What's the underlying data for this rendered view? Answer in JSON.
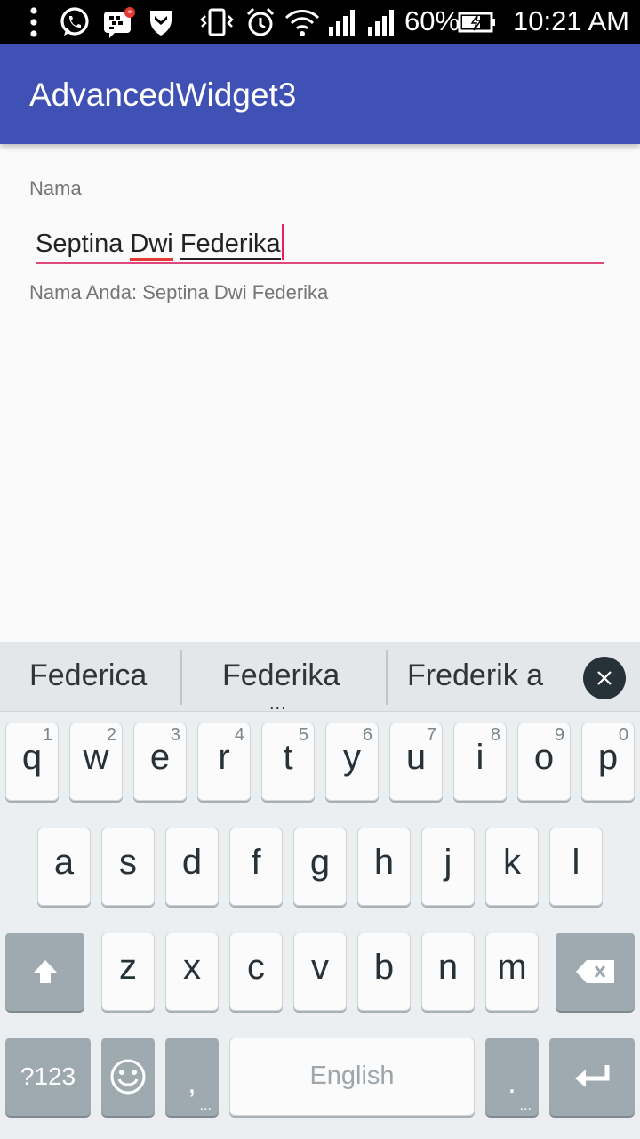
{
  "status_bar": {
    "battery_percent": "60%",
    "time": "10:21 AM",
    "icons": [
      "overflow-menu-icon",
      "whatsapp-icon",
      "bbm-icon",
      "shield-icon",
      "vibrate-icon",
      "alarm-icon",
      "wifi-icon",
      "signal-icon",
      "signal-icon-2",
      "battery-charging-icon"
    ]
  },
  "app_bar": {
    "title": "AdvancedWidget3",
    "color": "#3f51b5"
  },
  "form": {
    "label": "Nama",
    "input_value": "Septina Dwi Federika",
    "input_word_1": "Septina ",
    "input_word_2": "Dwi",
    "input_word_3": "Federika",
    "output": "Nama Anda: Septina Dwi Federika",
    "accent_color": "#e91e63"
  },
  "keyboard": {
    "suggestions": [
      "Federica",
      "Federika",
      "Frederik a"
    ],
    "suggestion_more": "...",
    "row1": [
      {
        "k": "q",
        "h": "1"
      },
      {
        "k": "w",
        "h": "2"
      },
      {
        "k": "e",
        "h": "3"
      },
      {
        "k": "r",
        "h": "4"
      },
      {
        "k": "t",
        "h": "5"
      },
      {
        "k": "y",
        "h": "6"
      },
      {
        "k": "u",
        "h": "7"
      },
      {
        "k": "i",
        "h": "8"
      },
      {
        "k": "o",
        "h": "9"
      },
      {
        "k": "p",
        "h": "0"
      }
    ],
    "row2": [
      "a",
      "s",
      "d",
      "f",
      "g",
      "h",
      "j",
      "k",
      "l"
    ],
    "row3": [
      "z",
      "x",
      "c",
      "v",
      "b",
      "n",
      "m"
    ],
    "symbols_label": "?123",
    "comma_label": ",",
    "space_label": "English",
    "period_label": ".",
    "more_dots": "..."
  }
}
